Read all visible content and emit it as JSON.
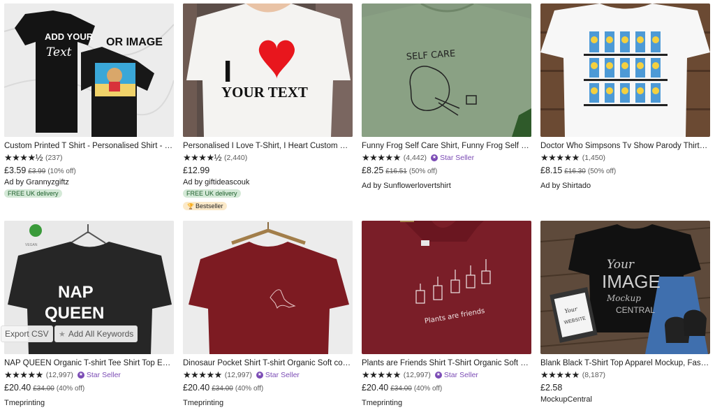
{
  "listings": [
    {
      "title": "Custom Printed T Shirt - Personalised Shirt - Cu...",
      "stars": "★★★★½",
      "reviews": "(237)",
      "star_seller": "",
      "price": "£3.59",
      "original_price": "£3.99",
      "discount": "(10% off)",
      "seller": "Ad by Grannyzgiftz",
      "free_delivery": "FREE UK delivery",
      "bestseller": "",
      "image_text": [
        "ADD YOUR",
        "Text",
        "OR IMAGE"
      ]
    },
    {
      "title": "Personalised I Love T-Shirt, I Heart Custom Shir...",
      "stars": "★★★★½",
      "reviews": "(2,440)",
      "star_seller": "",
      "price": "£12.99",
      "original_price": "",
      "discount": "",
      "seller": "Ad by giftideascouk",
      "free_delivery": "FREE UK delivery",
      "bestseller": "Bestseller",
      "image_text": [
        "I",
        "YOUR TEXT"
      ]
    },
    {
      "title": "Funny Frog Self Care Shirt, Funny Frog Self Car...",
      "stars": "★★★★★",
      "reviews": "(4,442)",
      "star_seller": "Star Seller",
      "price": "£8.25",
      "original_price": "£16.51",
      "discount": "(50% off)",
      "seller": "Ad by Sunflowerlovertshirt",
      "free_delivery": "",
      "bestseller": "",
      "image_text": [
        "SELF CARE"
      ]
    },
    {
      "title": "Doctor Who Simpsons Tv Show Parody Thirtee...",
      "stars": "★★★★★",
      "reviews": "(1,450)",
      "star_seller": "",
      "price": "£8.15",
      "original_price": "£16.30",
      "discount": "(50% off)",
      "seller": "Ad by Shirtado",
      "free_delivery": "",
      "bestseller": "",
      "image_text": []
    },
    {
      "title": "NAP QUEEN Organic T-shirt Tee Shirt Top Eco F...",
      "stars": "★★★★★",
      "reviews": "(12,997)",
      "star_seller": "Star Seller",
      "price": "£20.40",
      "original_price": "£34.00",
      "discount": "(40% off)",
      "seller": "Tmeprinting",
      "free_delivery": "",
      "bestseller": "",
      "image_text": [
        "NAP",
        "QUEEN",
        "VEGAN"
      ]
    },
    {
      "title": "Dinosaur Pocket Shirt T-shirt Organic Soft com...",
      "stars": "★★★★★",
      "reviews": "(12,997)",
      "star_seller": "Star Seller",
      "price": "£20.40",
      "original_price": "£34.00",
      "discount": "(40% off)",
      "seller": "Tmeprinting",
      "free_delivery": "",
      "bestseller": "",
      "image_text": []
    },
    {
      "title": "Plants are Friends Shirt T-Shirt Organic Soft Hi...",
      "stars": "★★★★★",
      "reviews": "(12,997)",
      "star_seller": "Star Seller",
      "price": "£20.40",
      "original_price": "£34.00",
      "discount": "(40% off)",
      "seller": "Tmeprinting",
      "free_delivery": "",
      "bestseller": "",
      "image_text": [
        "Plants are friends"
      ]
    },
    {
      "title": "Blank Black T-Shirt Top Apparel Mockup, Fashio...",
      "stars": "★★★★★",
      "reviews": "(8,187)",
      "star_seller": "",
      "price": "£2.58",
      "original_price": "",
      "discount": "",
      "seller": "MockupCentral",
      "free_delivery": "",
      "bestseller": "",
      "image_text": [
        "Your",
        "IMAGE",
        "Mockup",
        "CENTRAL",
        "Your",
        "WEBSITE"
      ]
    }
  ],
  "overlay": {
    "export_csv": "Export CSV",
    "add_keywords": "Add All Keywords"
  },
  "icons": {
    "star_seller": "star-seller-badge-icon",
    "bestseller": "trophy-icon",
    "keyword": "star-icon"
  },
  "colors": {
    "star_seller": "#7b4bb5",
    "free_delivery_bg": "#d4e9d7",
    "bestseller_bg": "#fbe9c9"
  }
}
